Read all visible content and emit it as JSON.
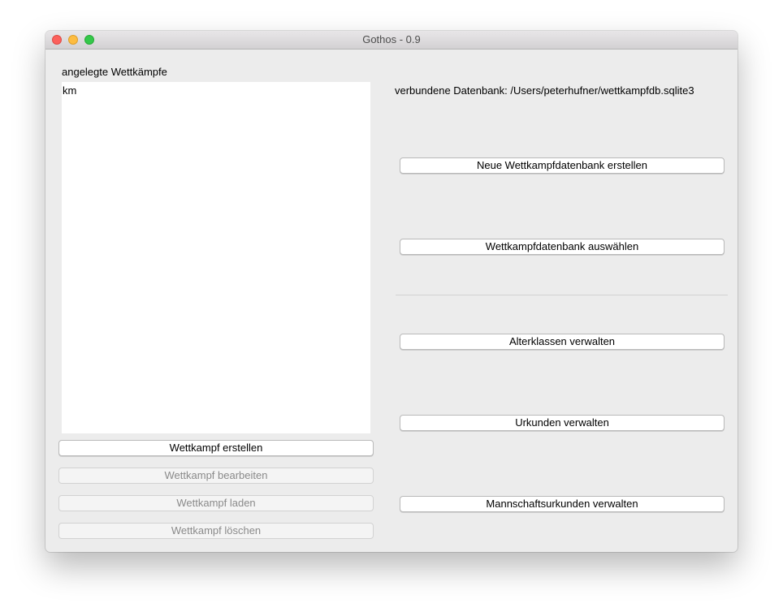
{
  "window": {
    "title": "Gothos - 0.9"
  },
  "competitions": {
    "heading": "angelegte Wettkämpfe",
    "items": [
      "km"
    ]
  },
  "database": {
    "connected_text": "verbundene Datenbank: /Users/peterhufner/wettkampfdb.sqlite3"
  },
  "left_buttons": {
    "create": "Wettkampf erstellen",
    "edit": "Wettkampf bearbeiten",
    "load": "Wettkampf laden",
    "delete": "Wettkampf löschen"
  },
  "right_buttons": {
    "new_db": "Neue Wettkampfdatenbank erstellen",
    "select_db": "Wettkampfdatenbank auswählen",
    "age_classes": "Alterklassen verwalten",
    "certificates": "Urkunden verwalten",
    "team_certificates": "Mannschaftsurkunden verwalten"
  },
  "traffic_lights": {
    "close_color": "#fc605c",
    "minimize_color": "#fdbc40",
    "maximize_color": "#34c84a"
  }
}
